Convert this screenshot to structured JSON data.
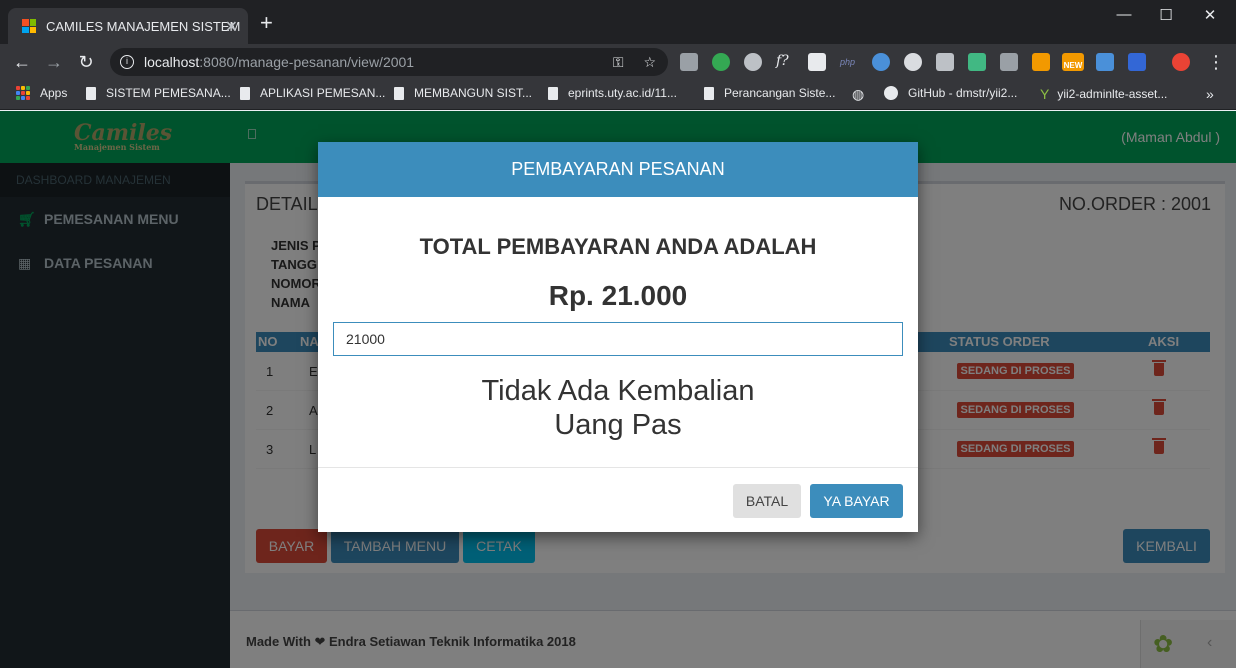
{
  "browser": {
    "tab_title": "CAMILES MANAJEMEN SISTEM",
    "url_host": "localhost",
    "url_path": ":8080/manage-pesanan/view/2001",
    "bookmarks": [
      "Apps",
      "SISTEM PEMESANA...",
      "APLIKASI PEMESAN...",
      "MEMBANGUN SIST...",
      "eprints.uty.ac.id/11...",
      "Perancangan Siste...",
      "GitHub - dmstr/yii2...",
      "yii2-adminlte-asset..."
    ],
    "new_badge": "NEW"
  },
  "app": {
    "logo_main": "Camiles",
    "logo_sub": "Manajemen Sistem",
    "user": "(Maman Abdul )"
  },
  "sidebar": {
    "header": "DASHBOARD MANAJEMEN",
    "items": [
      {
        "label": "PEMESANAN MENU",
        "icon": "cart-icon"
      },
      {
        "label": "DATA PESANAN",
        "icon": "grid-icon"
      }
    ]
  },
  "detail": {
    "title": "DETAIL",
    "order_no": "NO.ORDER : 2001",
    "info_labels": [
      "JENIS P",
      "TANGG",
      "NOMOR",
      "NAMA"
    ],
    "table": {
      "headers": {
        "no": "NO",
        "name": "NA",
        "status": "STATUS ORDER",
        "action": "AKSI"
      },
      "rows": [
        {
          "no": "1",
          "name": "E",
          "status": "SEDANG DI PROSES"
        },
        {
          "no": "2",
          "name": "A",
          "status": "SEDANG DI PROSES"
        },
        {
          "no": "3",
          "name": "L",
          "status": "SEDANG DI PROSES"
        }
      ]
    },
    "buttons": {
      "bayar": "BAYAR",
      "tambah": "TAMBAH MENU",
      "cetak": "CETAK",
      "kembali": "KEMBALI"
    }
  },
  "footer": {
    "text": "Made With ❤ Endra Setiawan Teknik Informatika 2018"
  },
  "modal": {
    "title": "PEMBAYARAN PESANAN",
    "total_label": "TOTAL PEMBAYARAN ANDA ADALAH",
    "amount": "Rp. 21.000",
    "input_value": "21000",
    "result_line1": "Tidak Ada Kembalian",
    "result_line2": "Uang Pas",
    "cancel": "BATAL",
    "confirm": "YA BAYAR"
  },
  "colors": {
    "header_green": "#00a65a",
    "primary_blue": "#3c8dbc",
    "danger_red": "#dd4b39",
    "sidebar_dark": "#222d32"
  }
}
